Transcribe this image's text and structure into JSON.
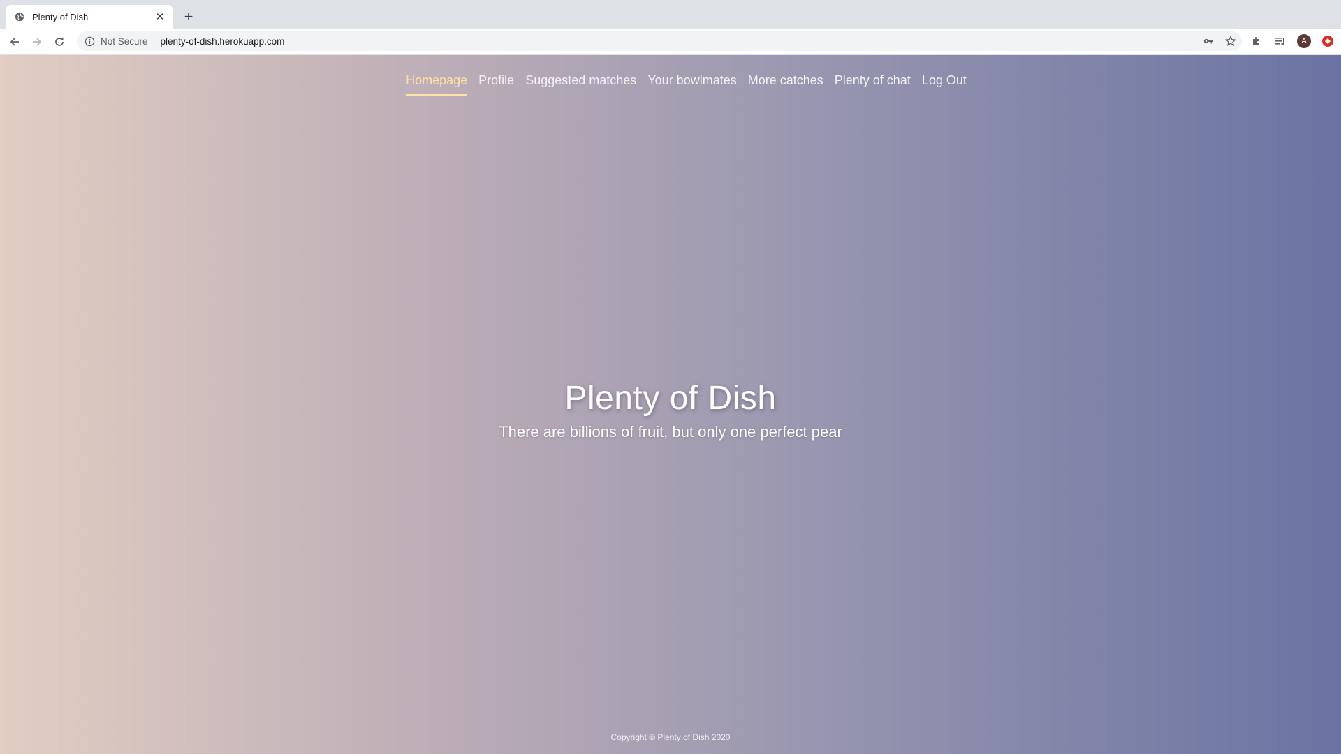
{
  "browser": {
    "tab": {
      "title": "Plenty of Dish",
      "favicon": "globe-icon"
    },
    "omnibox": {
      "security_label": "Not Secure",
      "url": "plenty-of-dish.herokuapp.com"
    },
    "profile_initial": "A"
  },
  "nav": {
    "items": [
      {
        "label": "Homepage",
        "active": true
      },
      {
        "label": "Profile"
      },
      {
        "label": "Suggested matches"
      },
      {
        "label": "Your bowlmates"
      },
      {
        "label": "More catches"
      },
      {
        "label": "Plenty of chat"
      },
      {
        "label": "Log Out"
      }
    ],
    "active_color": "#fbe3a6"
  },
  "hero": {
    "title": "Plenty of Dish",
    "subtitle": "There are billions of fruit, but only one perfect pear"
  },
  "footer": {
    "copyright": "Copyright © Plenty of Dish 2020"
  },
  "colors": {
    "gradient_start": "#e2cdc2",
    "gradient_end": "#6a73a2"
  }
}
